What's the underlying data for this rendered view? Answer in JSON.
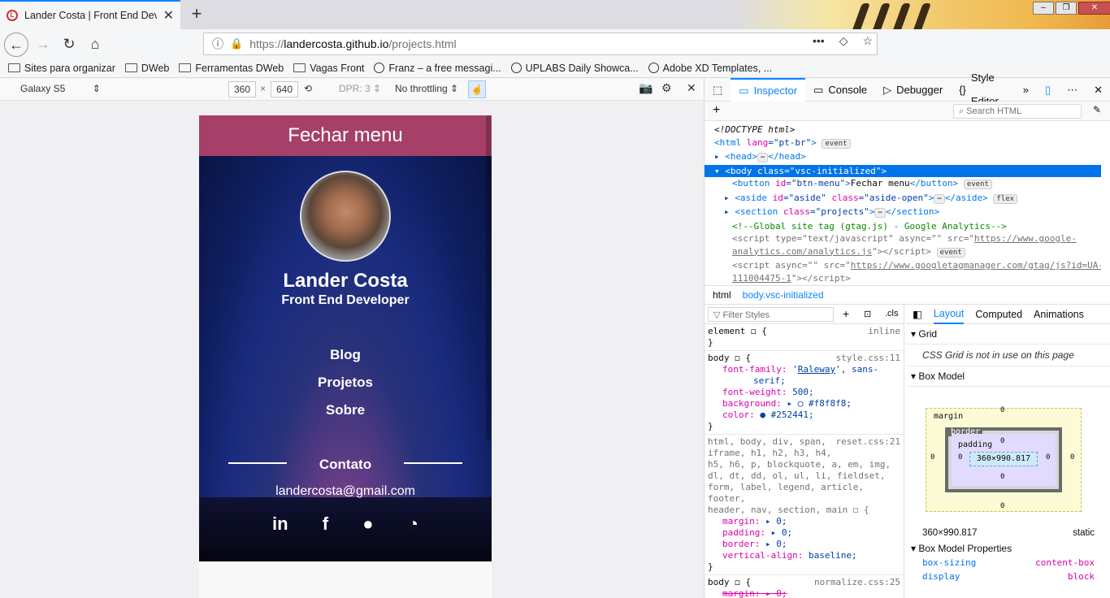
{
  "browser": {
    "tab_title": "Lander Costa | Front End Developer",
    "url_prefix": "https://",
    "url_host": "landercosta.github.io",
    "url_path": "/projects.html",
    "bookmarks": [
      {
        "label": "Sites para organizar",
        "icon": "folder-icon"
      },
      {
        "label": "DWeb",
        "icon": "folder-icon"
      },
      {
        "label": "Ferramentas DWeb",
        "icon": "folder-icon"
      },
      {
        "label": "Vagas Front",
        "icon": "folder-icon"
      },
      {
        "label": "Franz – a free messagi...",
        "icon": "globe-icon"
      },
      {
        "label": "UPLABS Daily Showca...",
        "icon": "globe-icon"
      },
      {
        "label": "Adobe XD Templates, ...",
        "icon": "globe-icon"
      }
    ]
  },
  "rdm": {
    "device": "Galaxy S5",
    "width": "360",
    "height": "640",
    "dpr": "DPR: 3",
    "throttling": "No throttling"
  },
  "page": {
    "menu_button": "Fechar menu",
    "name": "Lander Costa",
    "role": "Front End Developer",
    "links": [
      "Blog",
      "Projetos",
      "Sobre"
    ],
    "contact_title": "Contato",
    "email": "landercosta@gmail.com",
    "social": [
      "in",
      "f",
      "github",
      "rss"
    ]
  },
  "devtools": {
    "tabs": [
      "Inspector",
      "Console",
      "Debugger",
      "Style Editor"
    ],
    "search_placeholder": "Search HTML",
    "breadcrumbs": [
      "html",
      "body.vsc-initialized"
    ],
    "filter_placeholder": "Filter Styles",
    "cls_label": ".cls",
    "layout_tabs": [
      "Layout",
      "Computed",
      "Animations"
    ],
    "grid_title": "Grid",
    "grid_msg": "CSS Grid is not in use on this page",
    "boxmodel_title": "Box Model",
    "box_size": "360×990.817",
    "box_position": "static",
    "boxmodel_props_title": "Box Model Properties",
    "box_sizing_label": "box-sizing",
    "box_sizing_value": "content-box",
    "display_label": "display",
    "display_value": "block",
    "margin_label": "margin",
    "border_label": "border",
    "padding_label": "padding",
    "zero": "0"
  }
}
